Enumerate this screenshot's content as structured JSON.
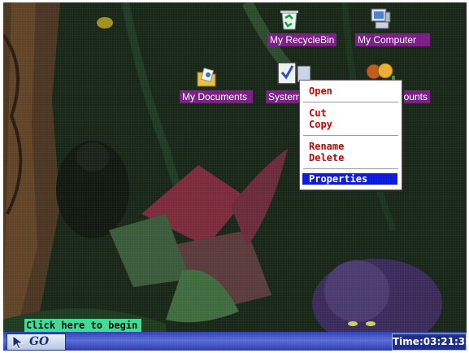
{
  "desktop": {
    "icons": [
      {
        "label": "My RecycleBin"
      },
      {
        "label": "My Computer"
      },
      {
        "label": "My Documents"
      },
      {
        "label": "System"
      },
      {
        "label": "Accounts"
      }
    ]
  },
  "context_menu": {
    "items": [
      "Open",
      "Cut",
      "Copy",
      "Rename",
      "Delete",
      "Properties"
    ],
    "selected": "Properties"
  },
  "hint": {
    "text": "Click here to begin"
  },
  "taskbar": {
    "start_label": "GO",
    "clock_text": "Time:03:21:35"
  },
  "colors": {
    "label_bg": "#7a1b86",
    "menu_text": "#c40000",
    "selection": "#0a18d8",
    "hint_bg": "#3bdc96"
  }
}
